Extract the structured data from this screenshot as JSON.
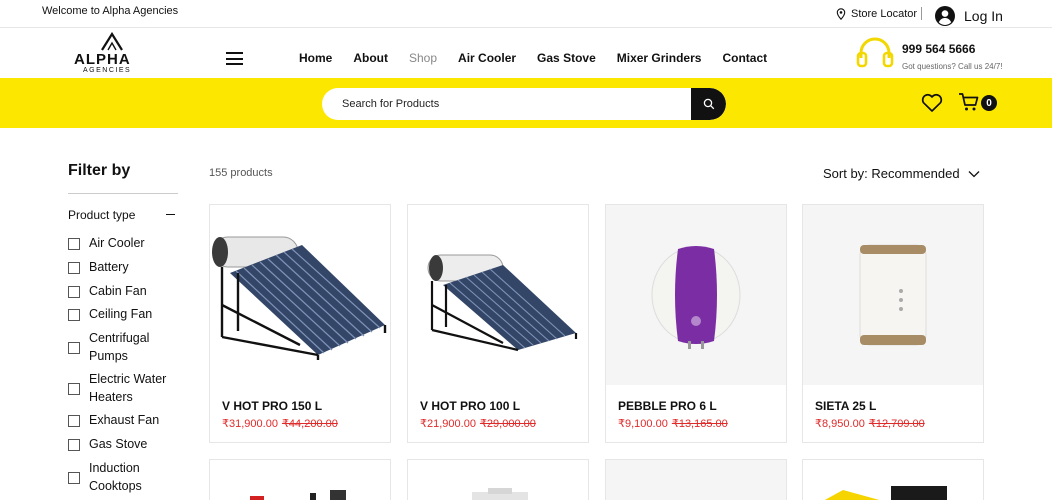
{
  "topbar": {
    "welcome": "Welcome to Alpha Agencies",
    "store_locator": "Store Locator",
    "login": "Log In"
  },
  "header": {
    "logo_word": "ALPHA",
    "logo_sub": "AGENCIES",
    "nav": [
      "Home",
      "About",
      "Shop",
      "Air Cooler",
      "Gas Stove",
      "Mixer Grinders",
      "Contact"
    ],
    "active_nav": "Shop",
    "phone": "999 564 5666",
    "support_note": "Got questions? Call us 24/7!"
  },
  "search": {
    "placeholder": "Search for Products"
  },
  "cart": {
    "count": "0"
  },
  "filter": {
    "title": "Filter by",
    "section": "Product type",
    "options": [
      "Air Cooler",
      "Battery",
      "Cabin Fan",
      "Ceiling Fan",
      "Centrifugal Pumps",
      "Electric Water Heaters",
      "Exhaust Fan",
      "Gas Stove",
      "Induction Cooktops"
    ]
  },
  "listing": {
    "count": "155 products",
    "sort": "Sort by: Recommended"
  },
  "products": [
    {
      "title": "V HOT PRO 150 L",
      "price": "₹31,900.00",
      "old_price": "₹44,200.00"
    },
    {
      "title": "V HOT PRO 100 L",
      "price": "₹21,900.00",
      "old_price": "₹29,000.00"
    },
    {
      "title": "PEBBLE PRO 6 L",
      "price": "₹9,100.00",
      "old_price": "₹13,165.00"
    },
    {
      "title": "SIETA 25 L",
      "price": "₹8,950.00",
      "old_price": "₹12,709.00"
    }
  ],
  "colors": {
    "band": "#fce700",
    "price_red": "#e02a2a",
    "accent_black": "#111111"
  }
}
